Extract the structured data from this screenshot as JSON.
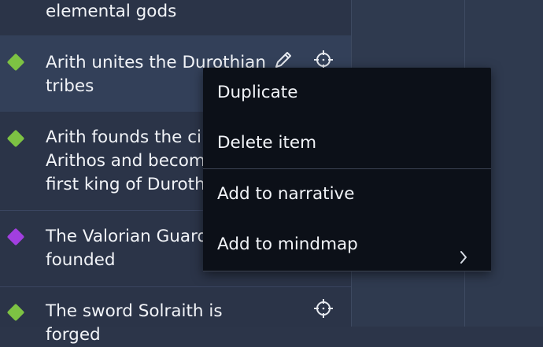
{
  "timeline": {
    "items": [
      {
        "text": "elemental gods",
        "color": null
      },
      {
        "text": "Arith unites the Durothian\ntribes",
        "color": "#7dc243"
      },
      {
        "text": "Arith founds the ci\nArithos and becom\nfirst king of Duroth",
        "color": "#7dc243"
      },
      {
        "text": "The Valorian Guard\nfounded",
        "color": "#a13fe0"
      },
      {
        "text": "The sword Solraith is forged",
        "color": "#7dc243"
      }
    ]
  },
  "context_menu": {
    "items": [
      {
        "label": "Duplicate"
      },
      {
        "label": "Delete item"
      },
      {
        "label": "Add to narrative"
      },
      {
        "label": "Add to mindmap"
      }
    ]
  },
  "icons": {
    "edit": "pencil-icon",
    "locate": "crosshair-icon",
    "submenu": "chevron-right-icon"
  }
}
